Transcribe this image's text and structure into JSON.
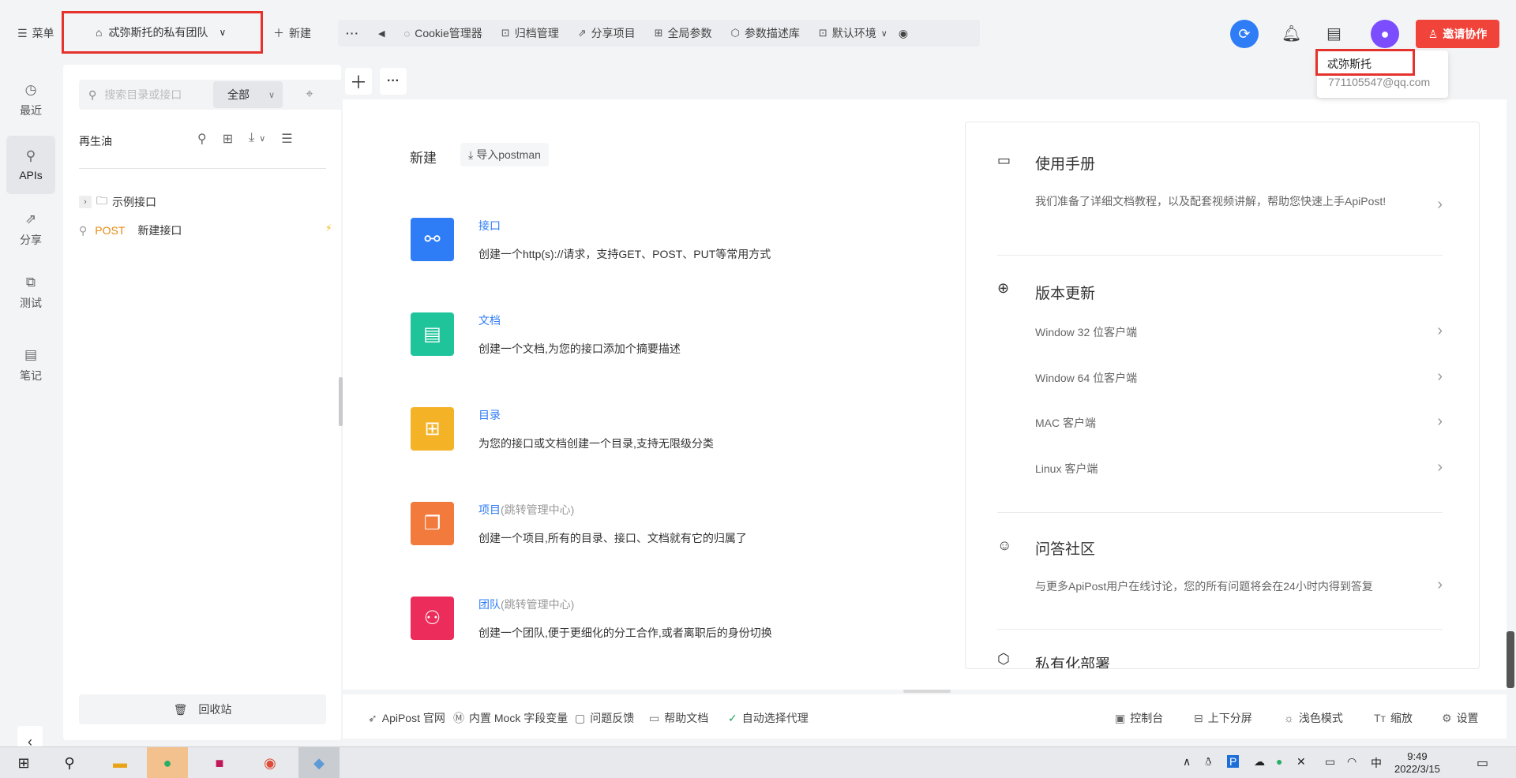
{
  "header": {
    "menu_label": "菜单",
    "team_name": "忒弥斯托的私有团队",
    "new_label": "新建",
    "toolbar": [
      {
        "icon": "cookie-icon",
        "label": "Cookie管理器"
      },
      {
        "icon": "archive-icon",
        "label": "归档管理"
      },
      {
        "icon": "share-icon",
        "label": "分享项目"
      },
      {
        "icon": "global-params-icon",
        "label": "全局参数"
      },
      {
        "icon": "cube-icon",
        "label": "参数描述库"
      },
      {
        "icon": "environment-icon",
        "label": "默认环境"
      }
    ],
    "invite_label": "邀请协作",
    "user_popup": {
      "name": "忒弥斯托",
      "email": "771105547@qq.com"
    }
  },
  "left_nav": [
    {
      "label": "最近",
      "icon": "clock-icon"
    },
    {
      "label": "APIs",
      "icon": "link-icon"
    },
    {
      "label": "分享",
      "icon": "share-icon"
    },
    {
      "label": "测试",
      "icon": "test-icon"
    },
    {
      "label": "笔记",
      "icon": "note-icon"
    }
  ],
  "tree": {
    "search_placeholder": "搜索目录或接口",
    "scope": "全部",
    "project_name": "再生油",
    "items": [
      {
        "type": "folder",
        "name": "示例接口"
      },
      {
        "type": "api",
        "method": "POST",
        "name": "新建接口"
      }
    ],
    "recycle_label": "回收站"
  },
  "main": {
    "new_title": "新建",
    "import_label": "导入postman",
    "create_items": [
      {
        "name": "接口",
        "suffix": "",
        "desc": "创建一个http(s)://请求，支持GET、POST、PUT等常用方式",
        "color": "#2e7cf6"
      },
      {
        "name": "文档",
        "suffix": "",
        "desc": "创建一个文档,为您的接口添加个摘要描述",
        "color": "#1fc49b"
      },
      {
        "name": "目录",
        "suffix": "",
        "desc": "为您的接口或文档创建一个目录,支持无限级分类",
        "color": "#f4b227"
      },
      {
        "name": "项目",
        "suffix": "(跳转管理中心)",
        "desc": "创建一个项目,所有的目录、接口、文档就有它的归属了",
        "color": "#f37a3d"
      },
      {
        "name": "团队",
        "suffix": "(跳转管理中心)",
        "desc": "创建一个团队,便于更细化的分工合作,或者离职后的身份切换",
        "color": "#ec2d5b"
      }
    ],
    "sections": {
      "manual": {
        "title": "使用手册",
        "desc": "我们准备了详细文档教程，以及配套视频讲解，帮助您快速上手ApiPost!"
      },
      "updates": {
        "title": "版本更新",
        "rows": [
          "Window 32 位客户端",
          "Window 64 位客户端",
          "MAC 客户端",
          "Linux 客户端"
        ]
      },
      "community": {
        "title": "问答社区",
        "desc": "与更多ApiPost用户在线讨论，您的所有问题将会在24小时内得到答复"
      },
      "private": {
        "title": "私有化部署"
      }
    }
  },
  "footer": {
    "left": [
      "ApiPost 官网",
      "内置 Mock 字段变量",
      "问题反馈",
      "帮助文档",
      "自动选择代理"
    ],
    "right": [
      "控制台",
      "上下分屏",
      "浅色模式",
      "缩放",
      "设置"
    ]
  },
  "taskbar": {
    "time": "9:49",
    "date": "2022/3/15",
    "ime": "中"
  }
}
